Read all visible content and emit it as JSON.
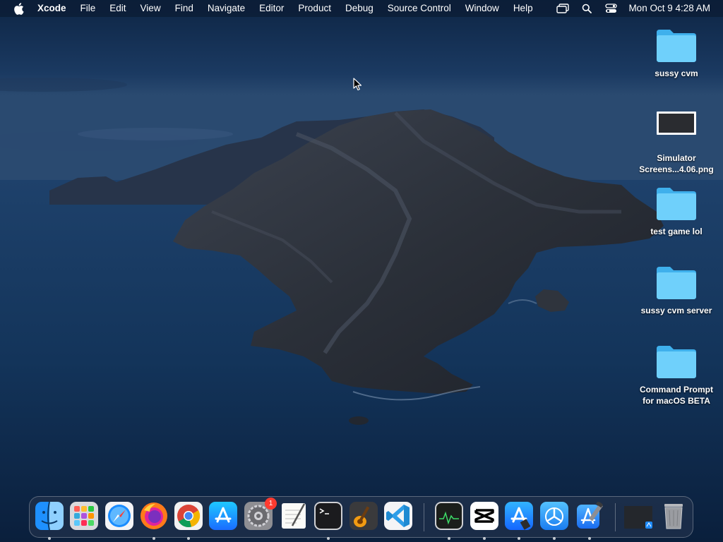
{
  "menubar": {
    "app_name": "Xcode",
    "menus": [
      "File",
      "Edit",
      "View",
      "Find",
      "Navigate",
      "Editor",
      "Product",
      "Debug",
      "Source Control",
      "Window",
      "Help"
    ],
    "clock": "Mon Oct 9  4:28 AM",
    "status_icons": [
      "screen-mirroring-icon",
      "search-icon",
      "control-center-icon"
    ]
  },
  "desktop": {
    "icons": [
      {
        "label": "sussy cvm",
        "kind": "folder"
      },
      {
        "label": "Simulator Screens...4.06.png",
        "kind": "screenshot"
      },
      {
        "label": "test game lol",
        "kind": "folder"
      },
      {
        "label": "sussy cvm server",
        "kind": "folder"
      },
      {
        "label": "Command Prompt for macOS BETA",
        "kind": "folder"
      }
    ]
  },
  "dock": {
    "apps": [
      {
        "name": "finder-icon",
        "running": true
      },
      {
        "name": "launchpad-icon",
        "running": false
      },
      {
        "name": "safari-icon",
        "running": false
      },
      {
        "name": "firefox-icon",
        "running": true
      },
      {
        "name": "chrome-icon",
        "running": true
      },
      {
        "name": "app-store-icon",
        "running": false
      },
      {
        "name": "system-settings-icon",
        "running": false,
        "badge": "1"
      },
      {
        "name": "textedit-icon",
        "running": false
      },
      {
        "name": "terminal-icon",
        "running": true
      },
      {
        "name": "garageband-icon",
        "running": false
      },
      {
        "name": "vscode-icon",
        "running": false
      },
      {
        "name": "activity-monitor-icon",
        "running": true
      },
      {
        "name": "capcut-icon",
        "running": true
      },
      {
        "name": "instruments-icon",
        "running": true
      },
      {
        "name": "testflight-icon",
        "running": true
      },
      {
        "name": "xcode-icon",
        "running": true
      },
      {
        "name": "recent-window-icon",
        "running": false
      },
      {
        "name": "trash-icon",
        "running": false
      }
    ]
  },
  "colors": {
    "menubar_bg": "#0c1c34",
    "folder_blue": "#5ac8fa",
    "badge_red": "#ff3b30",
    "wallpaper_sea": "#0e2a4d"
  }
}
